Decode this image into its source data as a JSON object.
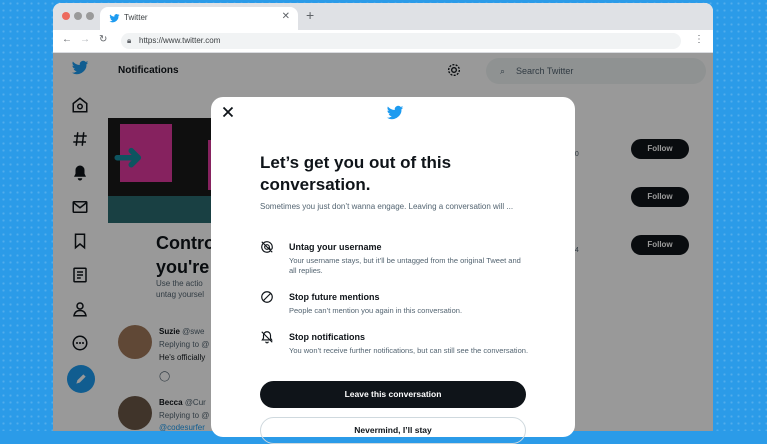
{
  "browser": {
    "tab_title": "Twitter",
    "url": "https://www.twitter.com"
  },
  "page": {
    "header_title": "Notifications",
    "search_placeholder": "Search Twitter",
    "hero_title_line1": "Contro",
    "hero_title_line2": "you're",
    "hero_sub_line1": "Use the actio",
    "hero_sub_line2": "untag yoursel",
    "tweets": [
      {
        "name": "Suzie",
        "handle": "@swe",
        "reply": "Replying to @",
        "text": "He's officially"
      },
      {
        "name": "Becca",
        "handle": "@Cur",
        "reply": "Replying to @",
        "text": "@codesurfer"
      }
    ],
    "follow_label": "Follow",
    "faint_meta": [
      "20",
      "24"
    ]
  },
  "modal": {
    "title": "Let’s get you out of this conversation.",
    "subtitle": "Sometimes you just don’t wanna engage. Leaving a conversation will ...",
    "options": [
      {
        "title": "Untag your username",
        "desc": "Your username stays, but it’ll be untagged from the original Tweet and all replies."
      },
      {
        "title": "Stop future mentions",
        "desc": "People can’t mention you again in this conversation."
      },
      {
        "title": "Stop notifications",
        "desc": "You won’t receive further notifications, but can still see the conversation."
      }
    ],
    "primary_label": "Leave this conversation",
    "secondary_label": "Nevermind, I’ll stay"
  },
  "colors": {
    "twitter_blue": "#1d9bf0",
    "background_blue": "#2b9be8",
    "primary_button": "#0f1419"
  },
  "icons": [
    "twitter-bird-icon",
    "home-icon",
    "hashtag-icon",
    "bell-icon",
    "mail-icon",
    "bookmark-icon",
    "list-icon",
    "profile-icon",
    "more-icon",
    "compose-icon",
    "gear-icon",
    "search-icon",
    "close-icon",
    "untag-icon",
    "block-icon",
    "bell-off-icon"
  ]
}
